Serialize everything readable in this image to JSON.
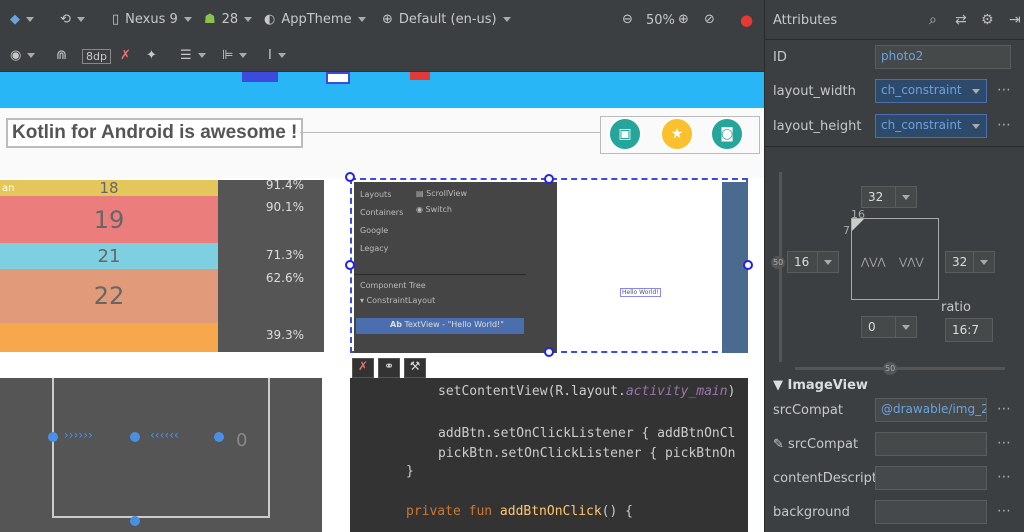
{
  "toolbar": {
    "device": "Nexus 9",
    "api": "28",
    "theme": "AppTheme",
    "locale": "Default (en-us)",
    "zoom": "50%",
    "margin": "8dp"
  },
  "canvas": {
    "title_text": "Kotlin for Android is awesome !",
    "bars": [
      {
        "label": "an",
        "value": "18",
        "pct": "91.4%",
        "color": "#e3c75b"
      },
      {
        "label": "",
        "value": "19",
        "pct": "90.1%",
        "color": "#ec7d7d"
      },
      {
        "label": "",
        "value": "21",
        "pct": "71.3%",
        "color": "#7ecfe0"
      },
      {
        "label": "",
        "value": "22",
        "pct": "62.6%",
        "color": "#e19b7b"
      },
      {
        "label": "",
        "value": "",
        "pct": "39.3%",
        "color": "#f7a74c"
      }
    ],
    "preview_left_items": [
      "Layouts",
      "Containers",
      "Google",
      "Legacy"
    ],
    "preview_widgets": [
      "ScrollView",
      "Switch"
    ],
    "component_tree_title": "Component Tree",
    "tree_root": "ConstraintLayout",
    "tree_child": "TextView - \"Hello World!\"",
    "tree_child_prefix": "Ab",
    "hello_world": "Hello World!",
    "zero_label": "0",
    "code_lines": [
      "setContentView(R.layout.",
      "activity_main",
      ")",
      "addBtn.setOnClickListener { addBtnOnCl",
      "pickBtn.setOnClickListener { pickBtnOn",
      "}",
      "private fun ",
      "addBtnOnClick",
      "() {"
    ]
  },
  "attributes": {
    "header": "Attributes",
    "id_label": "ID",
    "id_value": "photo2",
    "layout_width_label": "layout_width",
    "layout_width_value": "ch_constraint",
    "layout_height_label": "layout_height",
    "layout_height_value": "ch_constraint",
    "constraint_top": "32",
    "constraint_left": "16",
    "constraint_right": "32",
    "constraint_bottom": "0",
    "bias_16": "16",
    "bias_7": "7",
    "bias_50_left": "50",
    "bias_50_bottom": "50",
    "ratio_label": "ratio",
    "ratio_value": "16:7",
    "section": "ImageView",
    "src_label": "srcCompat",
    "src_value": "@drawable/img_2",
    "src2_label": "srcCompat",
    "content_label": "contentDescripti",
    "background_label": "background"
  },
  "colors": {
    "accent": "#29b6f6",
    "selection": "#2d4a6b",
    "link": "#6aa3e0"
  }
}
